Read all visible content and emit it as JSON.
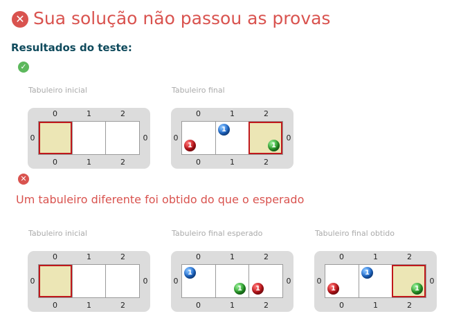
{
  "header": {
    "title": "Sua solução não passou as provas",
    "icon": "x-circle-icon",
    "color": "#d9534f"
  },
  "results_label": "Resultados do teste:",
  "tests": [
    {
      "status": "pass",
      "status_icon": "check-circle-icon",
      "error_message": "",
      "boards": [
        {
          "caption": "Tabuleiro inicial",
          "columns": [
            "0",
            "1",
            "2"
          ],
          "rows": [
            "0"
          ],
          "target_cell": 0,
          "balls": []
        },
        {
          "caption": "Tabuleiro final",
          "columns": [
            "0",
            "1",
            "2"
          ],
          "rows": [
            "0"
          ],
          "target_cell": 2,
          "balls": [
            {
              "cell": 0,
              "color": "red",
              "label": "1",
              "corner": "bottom-left"
            },
            {
              "cell": 1,
              "color": "blue",
              "label": "1",
              "corner": "top-left"
            },
            {
              "cell": 2,
              "color": "green",
              "label": "1",
              "corner": "bottom-right"
            }
          ]
        }
      ]
    },
    {
      "status": "fail",
      "status_icon": "x-circle-icon",
      "error_message": "Um tabuleiro diferente foi obtido do que o esperado",
      "boards": [
        {
          "caption": "Tabuleiro inicial",
          "columns": [
            "0",
            "1",
            "2"
          ],
          "rows": [
            "0"
          ],
          "target_cell": 0,
          "balls": []
        },
        {
          "caption": "Tabuleiro final esperado",
          "columns": [
            "0",
            "1",
            "2"
          ],
          "rows": [
            "0"
          ],
          "target_cell": -1,
          "balls": [
            {
              "cell": 0,
              "color": "blue",
              "label": "1",
              "corner": "top-left"
            },
            {
              "cell": 1,
              "color": "green",
              "label": "1",
              "corner": "bottom-right"
            },
            {
              "cell": 2,
              "color": "red",
              "label": "1",
              "corner": "bottom-left"
            }
          ]
        },
        {
          "caption": "Tabuleiro final obtido",
          "columns": [
            "0",
            "1",
            "2"
          ],
          "rows": [
            "0"
          ],
          "target_cell": 2,
          "balls": [
            {
              "cell": 0,
              "color": "red",
              "label": "1",
              "corner": "bottom-left"
            },
            {
              "cell": 1,
              "color": "blue",
              "label": "1",
              "corner": "top-left"
            },
            {
              "cell": 2,
              "color": "green",
              "label": "1",
              "corner": "bottom-right"
            }
          ]
        }
      ]
    }
  ]
}
